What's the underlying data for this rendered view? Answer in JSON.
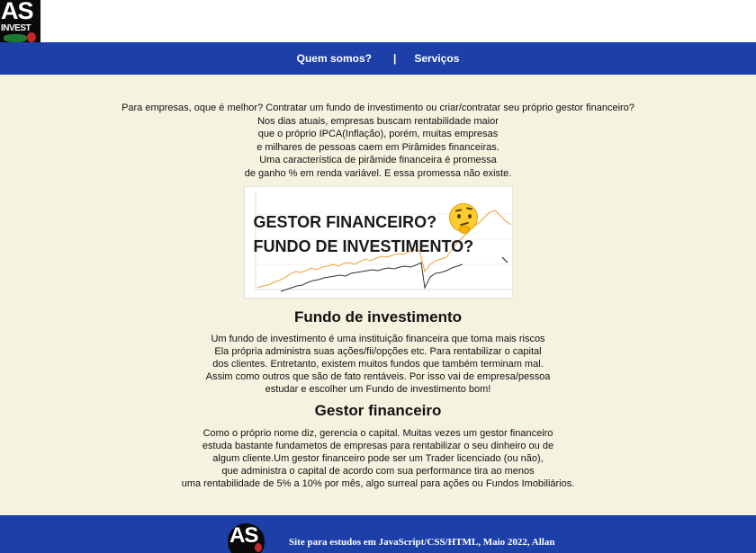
{
  "logo": {
    "top": "AS",
    "bottom": "INVEST"
  },
  "nav": {
    "items": [
      "Quem somos?",
      "Serviços"
    ],
    "separator": "|"
  },
  "intro": {
    "lines": [
      "Para empresas, oque é melhor? Contratar um fundo de investimento ou criar/contratar seu próprio gestor financeiro?",
      "Nos dias atuais, empresas buscam rentabilidade maior",
      "que o próprio IPCA(Inflação), porém, muitas empresas",
      "e milhares de pessoas caem em Pirâmides financeiras.",
      "Uma característica de pirâmide financeira é promessa",
      "de ganho % em renda variável. E essa promessa não existe."
    ]
  },
  "hero_image": {
    "line1": "GESTOR FINANCEIRO?",
    "line2": "FUNDO DE INVESTIMENTO?",
    "emoji": "thinking-face-icon",
    "colors": {
      "orange_series": "#f0a030",
      "dark_series": "#333333"
    }
  },
  "section_fund": {
    "title": "Fundo de investimento",
    "lines": [
      "Um fundo de investimento é uma instituição financeira que toma mais riscos",
      "Ela própria administra suas ações/fii/opções etc. Para rentabilizar o capital",
      "dos clientes. Entretanto, existem muitos fundos que também terminam mal.",
      "Assim como outros que são de fato rentáveis. Por isso vai de empresa/pessoa",
      "estudar e escolher um Fundo de investimento bom!"
    ]
  },
  "section_manager": {
    "title": "Gestor financeiro",
    "lines": [
      "Como o próprio nome diz, gerencia o capital. Muitas vezes um gestor financeiro",
      "estuda bastante fundametos de empresas para rentabilizar o seu dinheiro ou de",
      "algum cliente.Um gestor financeiro pode ser um Trader licenciado (ou não),",
      "que administra o capital de acordo com sua performance tira ao menos",
      "uma rentabilidade de 5% a 10% por mês, algo surreal para ações ou Fundos Imobiliários."
    ]
  },
  "footer": {
    "logo_text": "AS",
    "text": "Site para estudos em JavaScript/CSS/HTML, Maio 2022, Allan"
  },
  "colors": {
    "nav_bg": "#1d3fa8",
    "page_bg": "#f5f3df"
  }
}
